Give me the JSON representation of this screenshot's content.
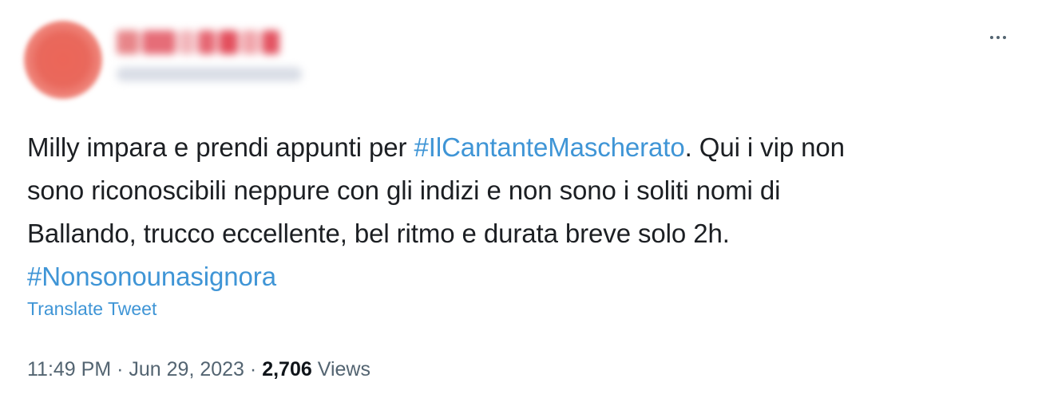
{
  "tweet": {
    "text_lines": [
      {
        "before": "Milly impara e prendi appunti per ",
        "hashtag": "#IlCantanteMascherato",
        "after": ". Qui i vip non"
      },
      {
        "text": "sono riconoscibili neppure con gli indizi e non sono i soliti nomi di"
      },
      {
        "text": "Ballando, trucco eccellente, bel ritmo e durata breve solo 2h."
      }
    ],
    "hashtag_line": "#Nonsonounasignora",
    "translate_label": "Translate Tweet",
    "time": "11:49 PM",
    "separator": "·",
    "date": "Jun 29, 2023",
    "views_count": "2,706",
    "views_label": "Views"
  },
  "colors": {
    "link": "#3f95d6",
    "text": "#1c1f23",
    "secondary": "#536471",
    "avatar": "#e9685c"
  },
  "icons": {
    "more": "more-horizontal-icon"
  }
}
